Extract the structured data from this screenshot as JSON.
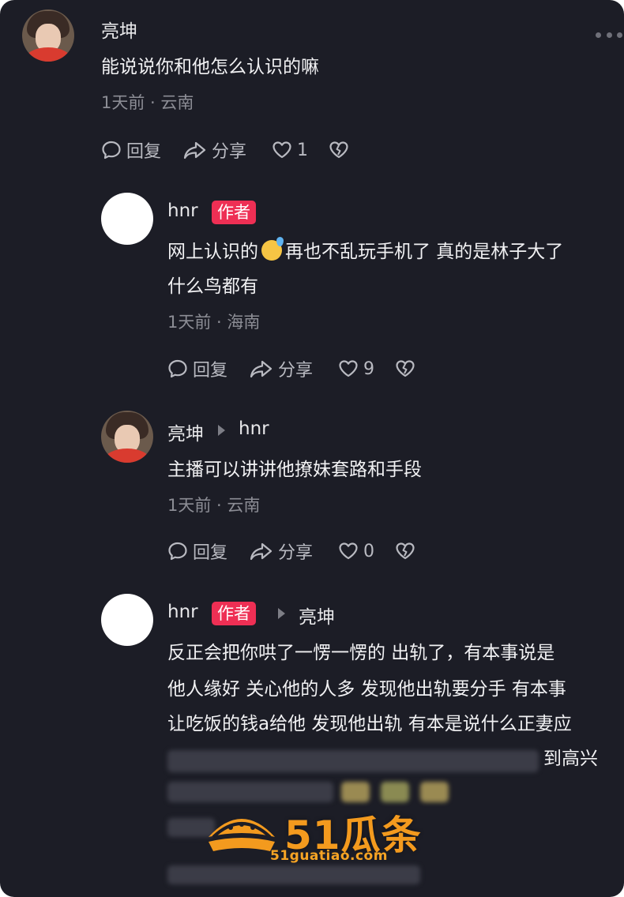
{
  "comments": [
    {
      "user": "亮坤",
      "text_lines": [
        "能说说你和他怎么认识的嘛"
      ],
      "meta": "1天前 · 云南",
      "actions": {
        "reply": "回复",
        "share": "分享",
        "likes": "1"
      }
    },
    {
      "user": "hnr",
      "badge": "作者",
      "text_line1_a": "网上认识的",
      "text_line1_b": "再也不乱玩手机了 真的是林子大了",
      "text_line2": "什么鸟都有",
      "meta": "1天前 · 海南",
      "actions": {
        "reply": "回复",
        "share": "分享",
        "likes": "9"
      }
    },
    {
      "user": "亮坤",
      "reply_to": "hnr",
      "text_lines": [
        "主播可以讲讲他撩妹套路和手段"
      ],
      "meta": "1天前 · 云南",
      "actions": {
        "reply": "回复",
        "share": "分享",
        "likes": "0"
      }
    },
    {
      "user": "hnr",
      "badge": "作者",
      "reply_to": "亮坤",
      "text_lines": [
        "反正会把你哄了一愣一愣的 出轨了，有本事说是",
        "他人缘好 关心他的人多 发现他出轨要分手  有本事",
        "让吃饭的钱a给他 发现他出轨 有本是说什么正妻应",
        "到高兴"
      ]
    }
  ],
  "watermark": {
    "brand": "51瓜条",
    "url": "51guatiao.com"
  },
  "colors": {
    "background": "#1c1d26",
    "badge": "#ee2f54",
    "watermark": "#f39a1e"
  }
}
